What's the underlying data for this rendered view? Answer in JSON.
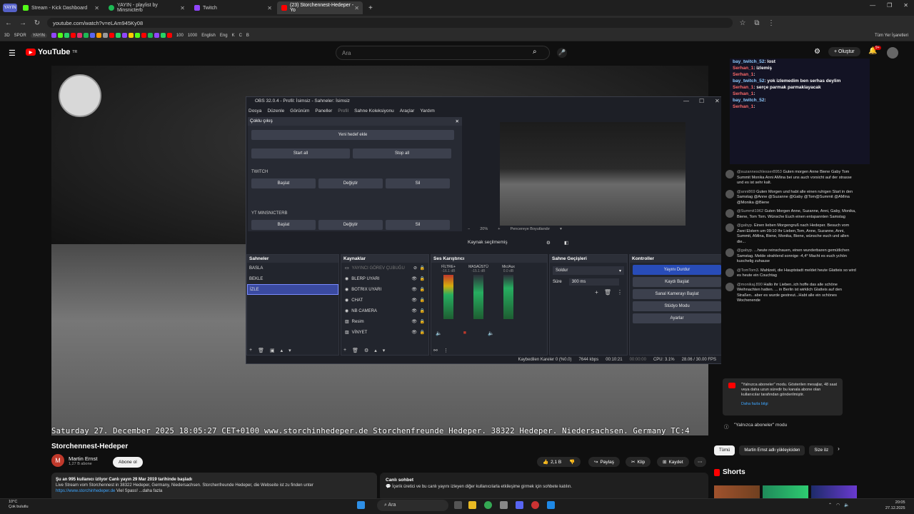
{
  "browser": {
    "pinned_label": "YAYIN",
    "tabs": [
      {
        "label": "Stream - Kick Dashboard",
        "color": "#53fc18"
      },
      {
        "label": "YAYIN - playlist by Minsnicterb",
        "color": "#1db954"
      },
      {
        "label": "Twitch",
        "color": "#9146ff"
      },
      {
        "label": "(23) Storchennest-Hedeper - Yo",
        "color": "#ff0000"
      }
    ],
    "url": "youtube.com/watch?v=eLAm945Ky08",
    "bookmarks": [
      "3D",
      "SPOR",
      "YAYIN",
      "100",
      "1000",
      "English",
      "Eng",
      "K",
      "C",
      "B"
    ],
    "all_bookmarks": "Tüm Yer İşaretleri"
  },
  "youtube": {
    "logo": "YouTube",
    "logo_sup": "TR",
    "search_placeholder": "Ara",
    "create_label": "Oluştur",
    "notifications": "9+",
    "video_title": "Storchennest-Hedeper",
    "timestamp_overlay": "Saturday 27. December 2025   18:05:27   CET+0100  www.storchinhedeper.de  Storchenfreunde Hedeper.  38322 Hedeper.  Niedersachsen.  Germany    TC:4",
    "channel_name": "Martin Ernst",
    "channel_avatar": "M",
    "channel_subs": "1,27 B abone",
    "subscribe_label": "Abone ol",
    "likes": "2,1 B",
    "share_label": "Paylaş",
    "clip_label": "Klip",
    "save_label": "Kaydet",
    "desc_line1": "Şu an 995 kullanıcı izliyor  Canlı yayın 29 Mar 2019 tarihinde başladı",
    "desc_line2": "Live Stream vom Storchennest in 38322 Hedeper, Germany, Niedersachsen. Storchenfreunde Hedeper, die  Webseite ist zu finden unter",
    "desc_link": "https://www.storchinhedeper.de",
    "desc_more": " Viel Spass! ...daha fazla",
    "livechat_title": "Canlı sohbet",
    "livechat_text": "İçerik üretici ve bu canlı yayını izleyen diğer kullanıcılarla etkileşime girmek için sohbete katılın.",
    "chips": [
      "Tümü",
      "Martin Ernst adlı yükleyiciden",
      "Size öz"
    ],
    "shorts_label": "Shorts"
  },
  "obs": {
    "title": "OBS 32.0.4 - Profil: İsimsiz - Sahneler: İsimsiz",
    "menu": [
      "Dosya",
      "Düzenle",
      "Görünüm",
      "Paneller",
      "Profil",
      "Sahne Koleksiyonu",
      "Araçlar",
      "Yardım"
    ],
    "multi_title": "Çoklu çıkış",
    "add_target": "Yeni hedef ekle",
    "start_all": "Start all",
    "stop_all": "Stop all",
    "target1": "TWITCH",
    "target2": "YT MINSNICTERB",
    "start": "Başlat",
    "change": "Değiştir",
    "delete": "Sil",
    "zoom": "20%",
    "fit": "Pencereye Boyutlandır",
    "no_source": "Kaynak seçilmemiş",
    "scenes_title": "Sahneler",
    "scenes": [
      "BASLA",
      "BEKLE",
      "İZLE"
    ],
    "sources_title": "Kaynaklar",
    "sources": [
      "YAYINCI GÖREV ÇUBUĞU",
      "BLERP UYARI",
      "BOTRIX UYARI",
      "CHAT",
      "NB CAMERA",
      "Resim",
      "VİNYET"
    ],
    "mixer_title": "Ses Karıştırıcı",
    "mixer_channels": [
      {
        "name": "FİLTRE+",
        "db": "-16.1 dB"
      },
      {
        "name": "MASAÜSTÜ",
        "db": "-15.1 dB"
      },
      {
        "name": "Mic/Aux",
        "db": "0.0 dB"
      }
    ],
    "transitions_title": "Sahne Geçişleri",
    "transition": "Soldur",
    "duration_label": "Süre",
    "duration": "300 ms",
    "controls_title": "Kontroller",
    "controls": [
      "Yayını Durdur",
      "Kaydı Başlat",
      "Sanal Kamerayı Başlat",
      "Stüdyo Modu",
      "Ayarlar"
    ],
    "status": {
      "dropped": "Kaybedilen Kareler 0 (%0.0)",
      "bitrate": "7644 kbps",
      "live_time": "00:10:21",
      "rec_time": "00:00:00",
      "cpu": "CPU: 3.1%",
      "fps": "28.06 / 30.00 FPS"
    }
  },
  "overlay_chat": [
    {
      "user": "bay_twitch_52",
      "text": ": lost"
    },
    {
      "user": "Serhan_1",
      "text": ": izlemiş"
    },
    {
      "user": "Serhan_1",
      "text": ": "
    },
    {
      "user": "bay_twitch_52",
      "text": ": yok izlemedim ben serhas deylim"
    },
    {
      "user": "Serhan_1",
      "text": ": serçe parmak parmaklayacak"
    },
    {
      "user": "Serhan_1",
      "text": ": "
    },
    {
      "user": "bay_twitch_52",
      "text": ": "
    },
    {
      "user": "Serhan_1",
      "text": ": "
    }
  ],
  "yt_chat": [
    {
      "name": "@suzanneschlesser8953",
      "text": "Guten morgen Anne Biene Gaby Tom Summit Monika Anni AMina bei uns auch vorsicht auf der strasse und es ist sehr kalt."
    },
    {
      "name": "@anni869",
      "text": "Guten Morgen und habt alle einen ruhigen Start in den Samstag @Anne @Suzanne @Gaby @Tom@Summit @AMina @Monika @Biene"
    },
    {
      "name": "@Summit1962",
      "text": "Guten Morgen Anne, Suzanne, Anni, Gaby, Monika, Biene, Tom Tom. Wünsche Euch einen entspannten Samstag"
    },
    {
      "name": "@gabyp.",
      "text": "Einen lieben Morgengruß nach Hedeper. Besuch vom Zwei Elstern um 09:10 Ihr Lieben,Tom, Anne, Suzanne, Anni, Summit, AMina, Biene, Monika, Biene, wünsche euch und allen die..."
    },
    {
      "name": "@gabyp.",
      "text": "...heute reinschauen, einen wunderbaren gemütlichen Samstag. Melde strahlend sonnige -4,4° Macht es euch ychön kuschelig zuhause"
    },
    {
      "name": "@TomTom3.",
      "text": "Mahlzeit, die Hauptstadt meldet heute Glatteis so wird es heute ein Couchtag"
    },
    {
      "name": "@monikaj.890",
      "text": "Hallo ihr Lieben..ich hoffe das alle schöne Weihnachten hatten. ... in Berlin ist wirklich Glatteis auf den Straßen.. aber es wurde gestreut...Habt alle ein schönes Wochenende"
    }
  ],
  "sub_only": {
    "text": "\"Yalnızca aboneler\" modu. Gösterilen mesajlar, 48 saat veya daha uzun süredir bu kanala abone olan kullanıcılar tarafından gönderilmiştir.",
    "link": "Daha fazla bilgi",
    "bar": "\"Yalnızca aboneler\" modu"
  },
  "taskbar": {
    "weather_temp": "10°C",
    "weather_desc": "Çok bulutlu",
    "search": "Ara",
    "time": "20:05",
    "date": "27.12.2025"
  }
}
